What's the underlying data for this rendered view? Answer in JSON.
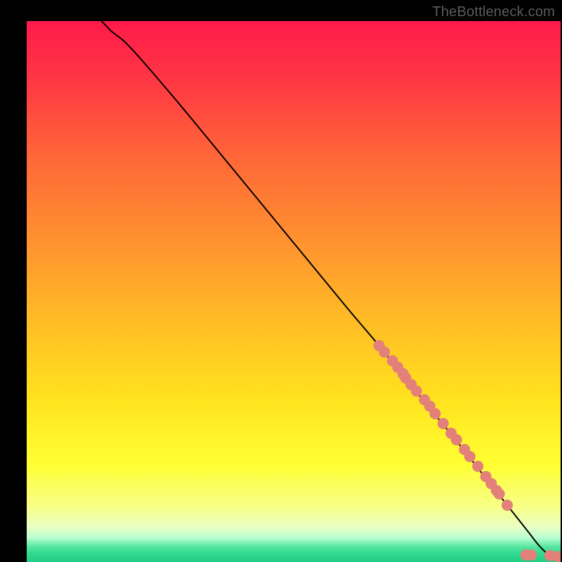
{
  "attribution": "TheBottleneck.com",
  "gradient_stops": [
    {
      "offset": 0.0,
      "color": "#ff1a4a"
    },
    {
      "offset": 0.1,
      "color": "#ff3444"
    },
    {
      "offset": 0.25,
      "color": "#ff6638"
    },
    {
      "offset": 0.4,
      "color": "#ff9030"
    },
    {
      "offset": 0.55,
      "color": "#ffbb26"
    },
    {
      "offset": 0.7,
      "color": "#ffe31e"
    },
    {
      "offset": 0.82,
      "color": "#ffff33"
    },
    {
      "offset": 0.9,
      "color": "#f7ff8a"
    },
    {
      "offset": 0.935,
      "color": "#eaffc4"
    },
    {
      "offset": 0.955,
      "color": "#b8ffcf"
    },
    {
      "offset": 0.972,
      "color": "#55e6a0"
    },
    {
      "offset": 0.985,
      "color": "#2fd98f"
    },
    {
      "offset": 1.0,
      "color": "#22cc84"
    }
  ],
  "marker_color": "#e38079",
  "marker_radius": 8,
  "curve_color": "#000000",
  "chart_data": {
    "type": "line",
    "title": "",
    "xlabel": "",
    "ylabel": "",
    "xlim": [
      0,
      100
    ],
    "ylim": [
      0,
      100
    ],
    "series": [
      {
        "name": "curve",
        "x": [
          14,
          15,
          16,
          18,
          20,
          24,
          30,
          40,
          50,
          60,
          66,
          70,
          75,
          80,
          84,
          88,
          90,
          92,
          94,
          96,
          98,
          100
        ],
        "y": [
          100,
          99,
          98,
          96.5,
          94.5,
          90,
          83,
          71,
          59,
          47,
          40,
          35,
          29,
          23,
          18,
          13,
          10.5,
          8,
          5.5,
          3,
          1.2,
          0.8
        ]
      }
    ],
    "markers": {
      "name": "dots",
      "color": "#e38079",
      "x": [
        66,
        67,
        68.5,
        69.5,
        70.5,
        71,
        72,
        73,
        74.5,
        75.5,
        76.5,
        78,
        79.5,
        80.5,
        82,
        83,
        84.5,
        86,
        87,
        88,
        88.5,
        90,
        93.5,
        94.5,
        98,
        99.5
      ],
      "y": [
        40,
        38.8,
        37.2,
        36,
        34.8,
        34,
        32.8,
        31.6,
        30,
        28.8,
        27.4,
        25.6,
        23.8,
        22.6,
        20.8,
        19.5,
        17.7,
        15.8,
        14.5,
        13.2,
        12.6,
        10.5,
        1.3,
        1.3,
        1.2,
        1.0
      ]
    }
  }
}
